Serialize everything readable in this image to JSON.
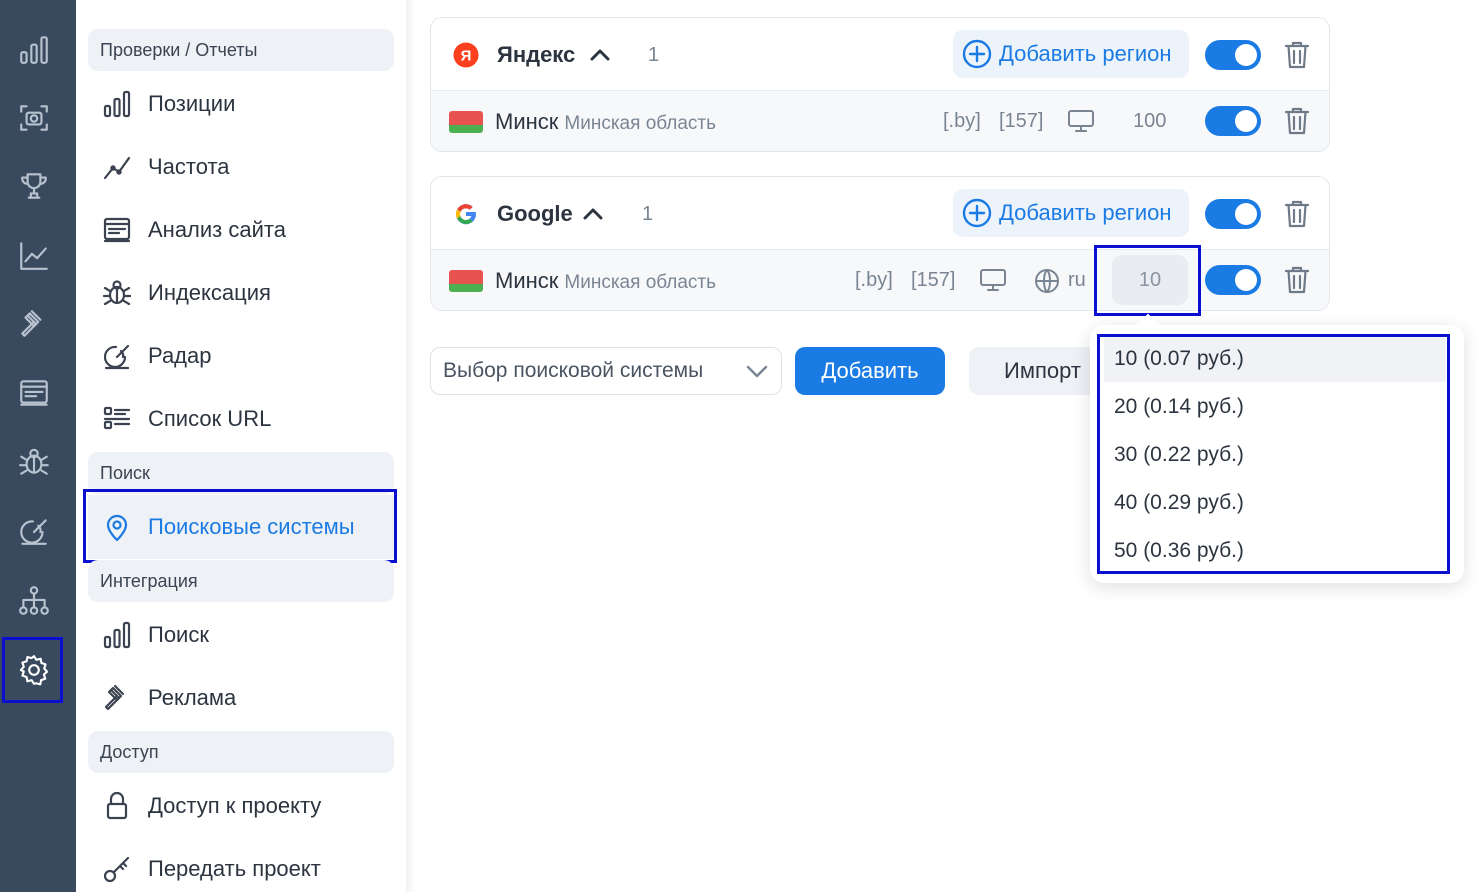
{
  "rail": {
    "icons": [
      "bar-chart-icon",
      "camera-scan-icon",
      "trophy-icon",
      "trend-chart-icon",
      "gavel-icon",
      "site-analysis-icon",
      "bug-icon",
      "radar-icon",
      "sitemap-icon",
      "gear-icon"
    ],
    "active": "gear-icon"
  },
  "nav": {
    "section_reports": "Проверки / Отчеты",
    "items_reports": [
      {
        "label": "Позиции",
        "icon": "bar-chart-icon"
      },
      {
        "label": "Частота",
        "icon": "trend-line-icon"
      },
      {
        "label": "Анализ сайта",
        "icon": "site-analysis-icon"
      },
      {
        "label": "Индексация",
        "icon": "bug-icon"
      },
      {
        "label": "Радар",
        "icon": "radar-icon"
      },
      {
        "label": "Список URL",
        "icon": "url-list-icon"
      }
    ],
    "section_search": "Поиск",
    "item_search_engines": {
      "label": "Поисковые системы",
      "icon": "location-pin-icon"
    },
    "section_integration": "Интеграция",
    "items_integration": [
      {
        "label": "Поиск",
        "icon": "bar-chart-icon"
      },
      {
        "label": "Реклама",
        "icon": "gavel-icon"
      }
    ],
    "section_access": "Доступ",
    "items_access": [
      {
        "label": "Доступ к проекту",
        "icon": "lock-icon"
      },
      {
        "label": "Передать проект",
        "icon": "key-icon"
      }
    ]
  },
  "engines": [
    {
      "name": "Яндекс",
      "count": "1",
      "add_region_label": "Добавить регион",
      "enabled": true,
      "regions": [
        {
          "city": "Минск",
          "region": "Минская область",
          "domain": "[.by]",
          "code": "[157]",
          "language": "",
          "depth": "100",
          "enabled": true
        }
      ]
    },
    {
      "name": "Google",
      "count": "1",
      "add_region_label": "Добавить регион",
      "enabled": true,
      "regions": [
        {
          "city": "Минск",
          "region": "Минская область",
          "domain": "[.by]",
          "code": "[157]",
          "language": "ru",
          "depth": "10",
          "enabled": true
        }
      ]
    }
  ],
  "controls": {
    "engine_select_placeholder": "Выбор поисковой системы",
    "add_button": "Добавить",
    "import_button": "Импорт"
  },
  "depth_dropdown": {
    "selected": "10",
    "options": [
      "10  (0.07 руб.)",
      "20  (0.14 руб.)",
      "30  (0.22 руб.)",
      "40  (0.29 руб.)",
      "50  (0.36 руб.)"
    ]
  },
  "colors": {
    "rail_bg": "#3a4a5e",
    "accent": "#1b7be4",
    "highlight_box": "#0b0fcf",
    "yandex_red": "#fc3f1d"
  }
}
